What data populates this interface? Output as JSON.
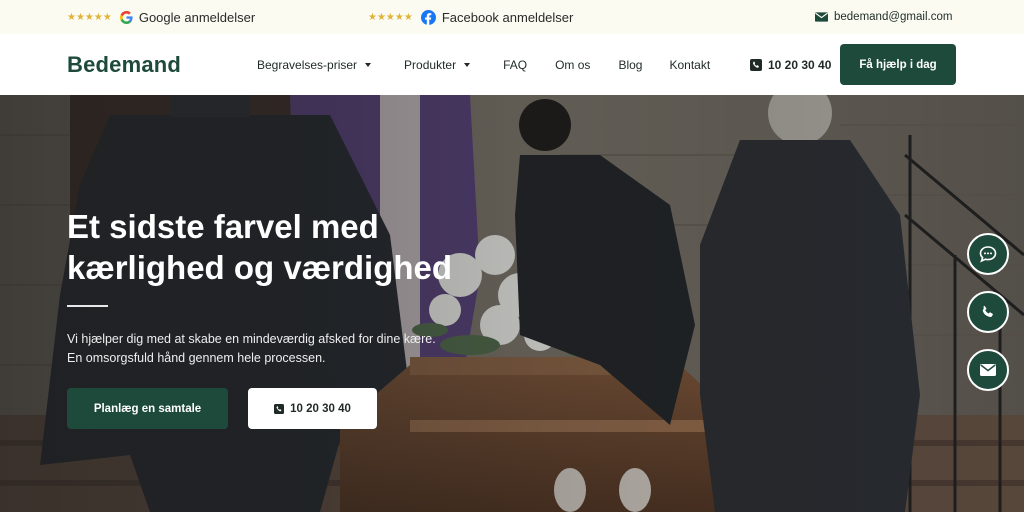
{
  "topbar": {
    "google": {
      "stars": "★★★★★",
      "label": "Google anmeldelser",
      "icon": "google-icon"
    },
    "facebook": {
      "stars": "★★★★★",
      "label": "Facebook anmeldelser",
      "icon": "facebook-icon"
    },
    "email": {
      "icon": "envelope-icon",
      "label": "bedemand@gmail.com"
    }
  },
  "nav": {
    "logo": "Bedemand",
    "items": [
      {
        "label": "Begravelses-priser",
        "dropdown": true
      },
      {
        "label": "Produkter",
        "dropdown": true
      },
      {
        "label": "FAQ",
        "dropdown": false
      },
      {
        "label": "Om os",
        "dropdown": false
      },
      {
        "label": "Blog",
        "dropdown": false
      },
      {
        "label": "Kontakt",
        "dropdown": false
      }
    ],
    "phone": "10 20 30 40",
    "cta": "Få hjælp i dag"
  },
  "hero": {
    "title_line1": "Et sidste farvel med",
    "title_line2": "kærlighed og værdighed",
    "subtitle_line1": "Vi hjælper dig med at skabe en mindeværdig afsked for dine kære.",
    "subtitle_line2": "En omsorgsfuld hånd gennem hele processen.",
    "primary_button": "Planlæg en samtale",
    "secondary_button": "10 20 30 40"
  },
  "floating_actions": [
    "chat-icon",
    "phone-icon",
    "envelope-icon"
  ],
  "colors": {
    "brand": "#1e4a3c",
    "star": "#e0b43a",
    "topbar_bg": "#fbfbf2"
  }
}
